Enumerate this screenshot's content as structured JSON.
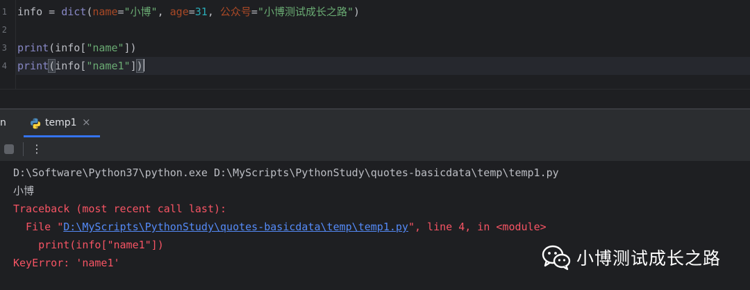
{
  "editor": {
    "line1": {
      "var": "info",
      "eq": " = ",
      "func": "dict",
      "open": "(",
      "p1": "name",
      "p1eq": "=",
      "v1": "\"小博\"",
      "sep1": ", ",
      "p2": "age",
      "p2eq": "=",
      "v2": "31",
      "sep2": ", ",
      "p3": "公众号",
      "p3eq": "=",
      "v3": "\"小博测试成长之路\"",
      "close": ")"
    },
    "line3": {
      "func": "print",
      "open": "(info[",
      "key": "\"name\"",
      "close": "])"
    },
    "line4": {
      "func": "print",
      "open_paren": "(",
      "mid": "info[",
      "key": "\"name1\"",
      "close_bracket": "]",
      "close_paren": ")"
    }
  },
  "run": {
    "label": "n",
    "tab_label": "temp1",
    "tab_close": "×",
    "kebab": "⋮"
  },
  "console": {
    "cmd": "D:\\Software\\Python37\\python.exe D:\\MyScripts\\PythonStudy\\quotes-basicdata\\temp\\temp1.py",
    "out1": "小博",
    "tb_header": "Traceback (most recent call last):",
    "file_prefix": "  File \"",
    "file_path": "D:\\MyScripts\\PythonStudy\\quotes-basicdata\\temp\\temp1.py",
    "file_suffix": "\", line 4, in <module>",
    "code_line": "    print(info[\"name1\"])",
    "error": "KeyError: 'name1'"
  },
  "watermark": {
    "text": "小博测试成长之路"
  }
}
